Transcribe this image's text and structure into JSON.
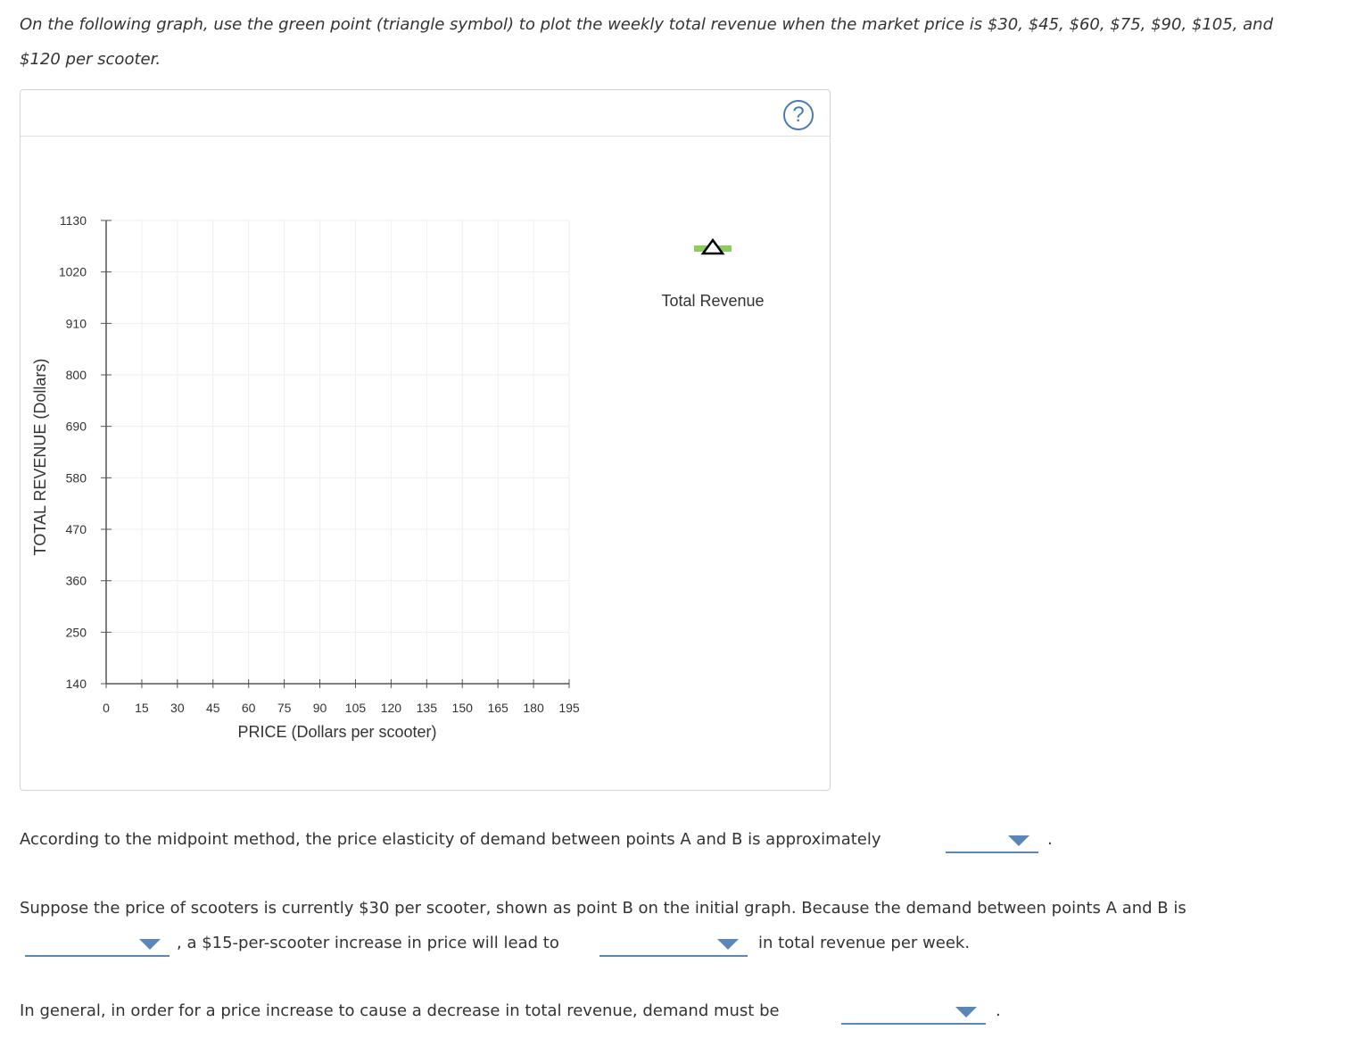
{
  "intro": {
    "text": "On the following graph, use the green point (triangle symbol) to plot the weekly total revenue when the market price is $30, $45, $60, $75, $90, $105, and $120 per scooter."
  },
  "graph": {
    "help_label": "?",
    "legend_label": "Total Revenue",
    "colors": {
      "point_green": "#8ccd5b",
      "grid": "#eeeeee",
      "axis": "#555555",
      "accent": "#5b86b8"
    },
    "chart_data": {
      "type": "scatter",
      "xlabel": "PRICE (Dollars per scooter)",
      "ylabel": "TOTAL REVENUE (Dollars)",
      "xlim": [
        0,
        195
      ],
      "ylim": [
        140,
        1130
      ],
      "x_ticks": [
        "0",
        "15",
        "30",
        "45",
        "60",
        "75",
        "90",
        "105",
        "120",
        "135",
        "150",
        "165",
        "180",
        "195"
      ],
      "y_ticks": [
        "140",
        "250",
        "360",
        "470",
        "580",
        "690",
        "800",
        "910",
        "1020",
        "1130"
      ],
      "grid": true,
      "series": [
        {
          "name": "Total Revenue",
          "marker": "triangle",
          "color": "#8ccd5b",
          "points": []
        }
      ]
    }
  },
  "questions": {
    "q1_text": "According to the midpoint method, the price elasticity of demand between points A and B is approximately",
    "q1_end": ".",
    "q2_text": "Suppose the price of scooters is currently $30 per scooter, shown as point B on the initial graph. Because the demand between points A and B is",
    "q2_mid": ", a $15-per-scooter increase in price will lead to",
    "q2_end": "in total revenue per week.",
    "q3_text": "In general, in order for a price increase to cause a decrease in total revenue, demand must be",
    "q3_end": "."
  },
  "dropdowns": {
    "elasticity_value": "",
    "demand_type": "",
    "revenue_change": "",
    "demand_must_be": ""
  }
}
